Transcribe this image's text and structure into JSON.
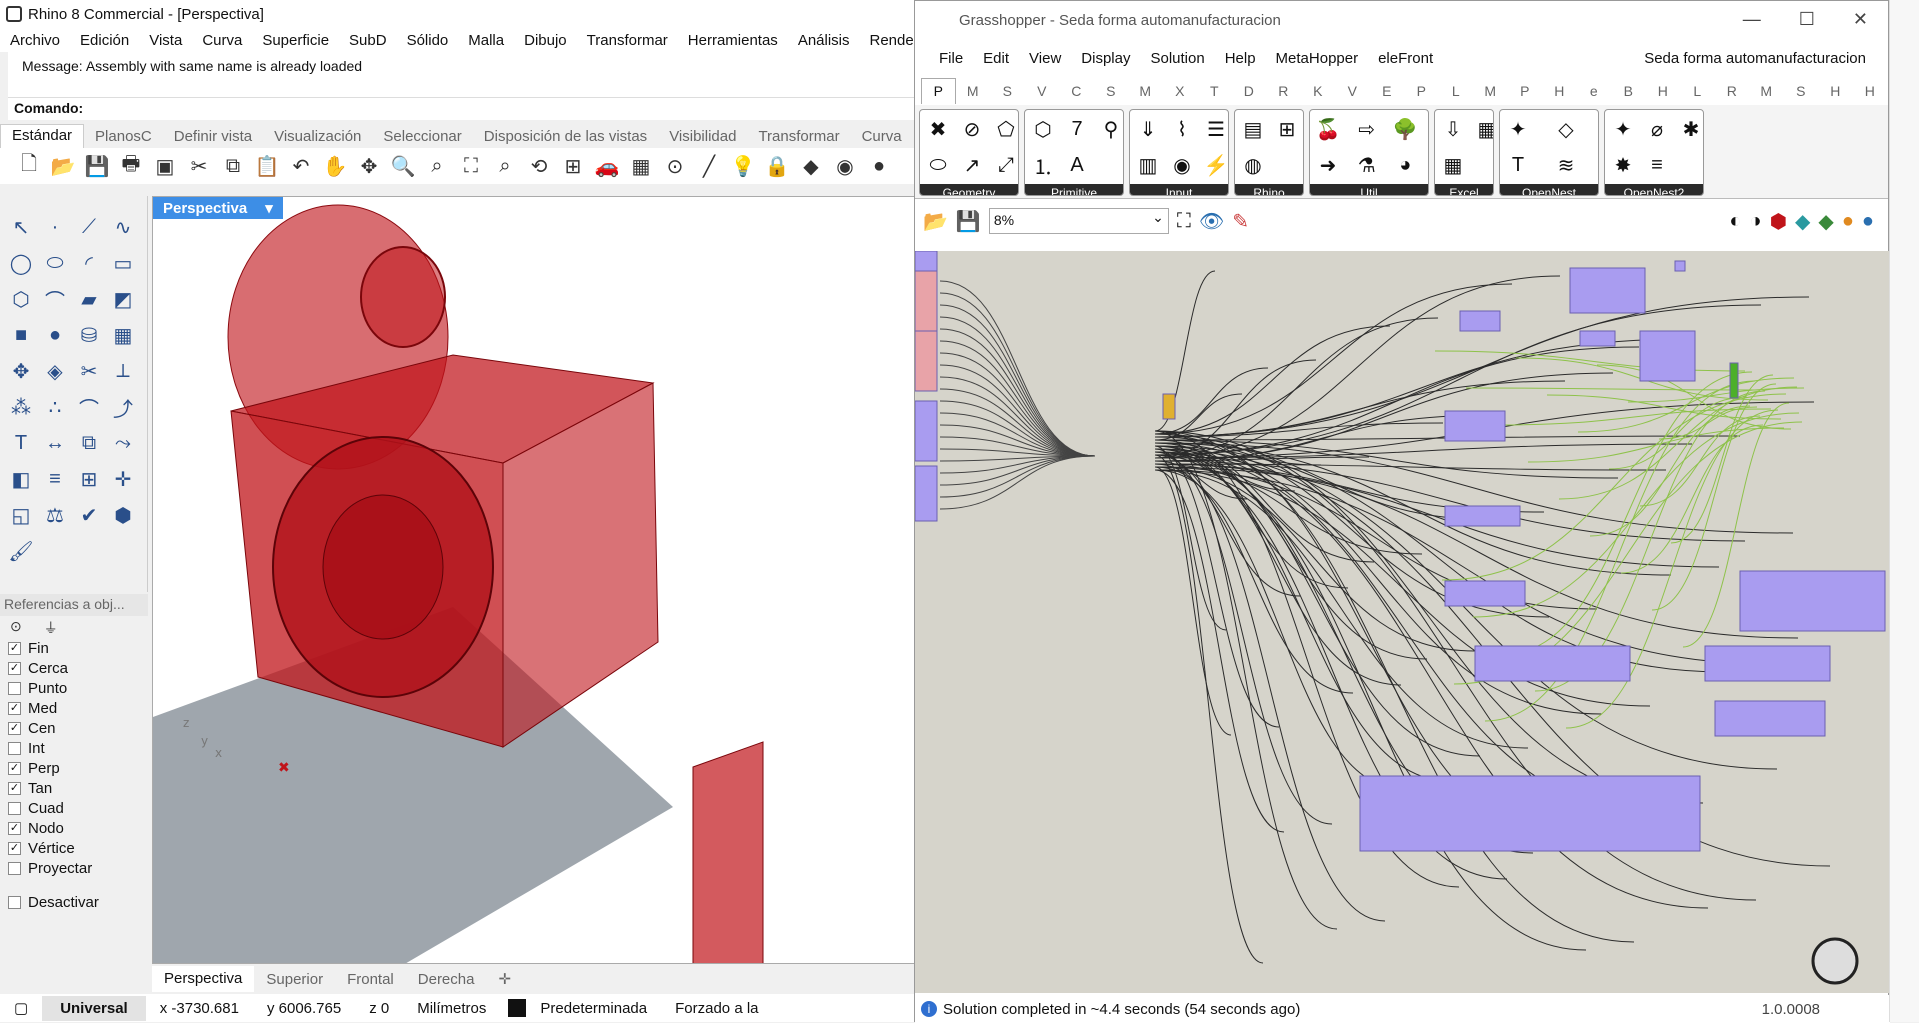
{
  "rhino": {
    "title": "Rhino 8 Commercial - [Perspectiva]",
    "menu": [
      "Archivo",
      "Edición",
      "Vista",
      "Curva",
      "Superficie",
      "SubD",
      "Sólido",
      "Malla",
      "Dibujo",
      "Transformar",
      "Herramientas",
      "Análisis",
      "Renderizad"
    ],
    "message": "Message: Assembly with same name is already loaded",
    "command_label": "Comando:",
    "toolbar_tabs": [
      "Estándar",
      "PlanosC",
      "Definir vista",
      "Visualización",
      "Seleccionar",
      "Disposición de las vistas",
      "Visibilidad",
      "Transformar",
      "Curva"
    ],
    "viewport_label": "Perspectiva",
    "viewport_tabs": [
      "Perspectiva",
      "Superior",
      "Frontal",
      "Derecha"
    ],
    "osnap_header": "Referencias a obj...",
    "osnaps": [
      {
        "label": "Fin",
        "checked": true
      },
      {
        "label": "Cerca",
        "checked": true
      },
      {
        "label": "Punto",
        "checked": false
      },
      {
        "label": "Med",
        "checked": true
      },
      {
        "label": "Cen",
        "checked": true
      },
      {
        "label": "Int",
        "checked": false
      },
      {
        "label": "Perp",
        "checked": true
      },
      {
        "label": "Tan",
        "checked": true
      },
      {
        "label": "Cuad",
        "checked": false
      },
      {
        "label": "Nodo",
        "checked": true
      },
      {
        "label": "Vértice",
        "checked": true
      },
      {
        "label": "Proyectar",
        "checked": false
      }
    ],
    "disable_label": "Desactivar",
    "status": {
      "cplane": "Universal",
      "x": "x -3730.681",
      "y": "y 6006.765",
      "z": "z 0",
      "units": "Milímetros",
      "layer": "Predeterminada",
      "extra": "Forzado a la"
    }
  },
  "gh": {
    "title": "Grasshopper - Seda forma automanufacturacion",
    "menu": [
      "File",
      "Edit",
      "View",
      "Display",
      "Solution",
      "Help",
      "MetaHopper",
      "eleFront"
    ],
    "doc_name": "Seda forma automanufacturacion",
    "categories": [
      "P",
      "M",
      "S",
      "V",
      "C",
      "S",
      "M",
      "X",
      "T",
      "D",
      "R",
      "K",
      "V",
      "E",
      "P",
      "L",
      "M",
      "P",
      "H",
      "e",
      "B",
      "H",
      "L",
      "R",
      "M",
      "S",
      "H",
      "H"
    ],
    "panels": [
      "Geometry",
      "Primitive",
      "Input",
      "Rhino",
      "Util",
      "Excel",
      "OpenNest",
      "OpenNest2"
    ],
    "zoom": "8%",
    "status": "Solution completed in ~4.4 seconds (54 seconds ago)",
    "version": "1.0.0008"
  },
  "colors": {
    "model_red": "#c0141a",
    "gh_canvas": "#d6d4cb",
    "gh_group": "#a99cf0",
    "accent_blue": "#3d8ee6"
  }
}
